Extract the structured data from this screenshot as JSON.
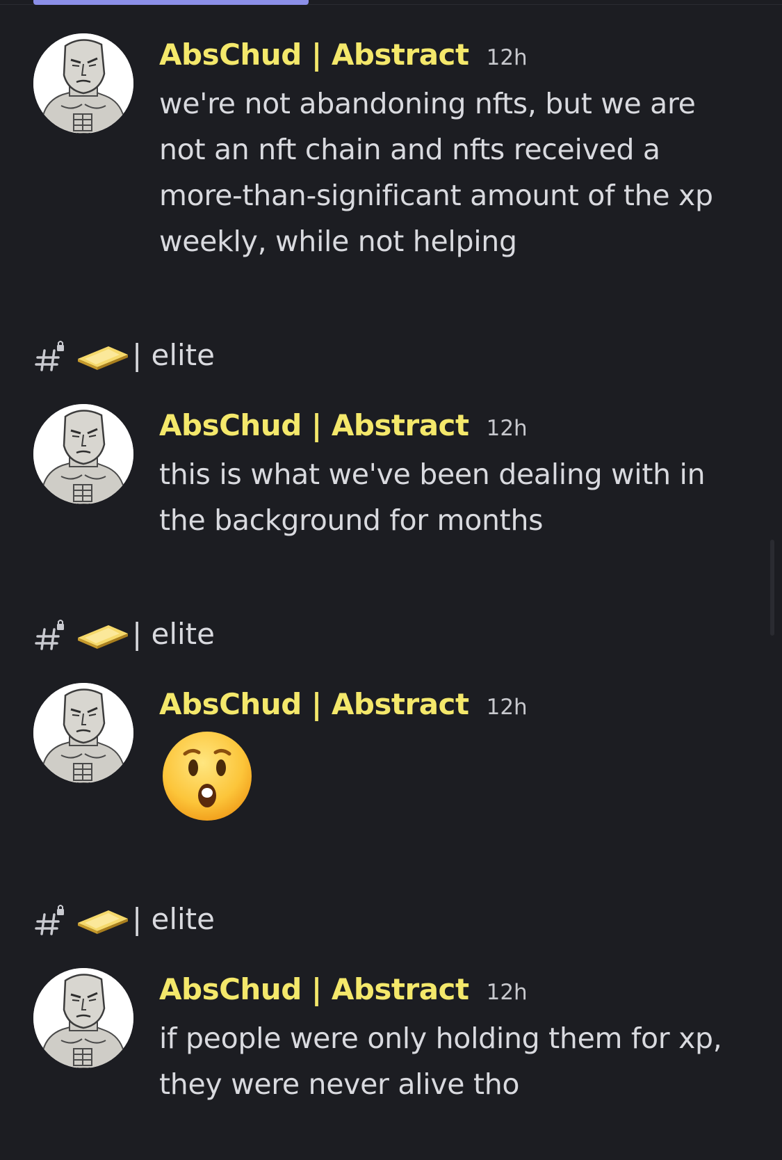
{
  "colors": {
    "background": "#1c1d22",
    "username": "#f4e86b",
    "text": "#d9dadf",
    "timestamp": "#c7c8cd",
    "accent": "#8b8fe8"
  },
  "messages": [
    {
      "username": "AbsChud | Abstract",
      "timestamp": "12h",
      "text": "we're not abandoning nfts, but we are not an nft chain and nfts received a more-than-significant amount of the xp weekly, while not helping"
    },
    {
      "username": "AbsChud | Abstract",
      "timestamp": "12h",
      "text": "this is what we've been dealing with in the background for months"
    },
    {
      "username": "AbsChud | Abstract",
      "timestamp": "12h",
      "emoji": "hushed-face-emoji"
    },
    {
      "username": "AbsChud | Abstract",
      "timestamp": "12h",
      "text": "if people were only holding them for xp, they were never alive tho"
    }
  ],
  "channels": [
    {
      "icon": "locked-hash-icon",
      "emoji": "gold-bar-icon",
      "name": "| elite"
    },
    {
      "icon": "locked-hash-icon",
      "emoji": "gold-bar-icon",
      "name": "| elite"
    },
    {
      "icon": "locked-hash-icon",
      "emoji": "gold-bar-icon",
      "name": "| elite"
    }
  ]
}
